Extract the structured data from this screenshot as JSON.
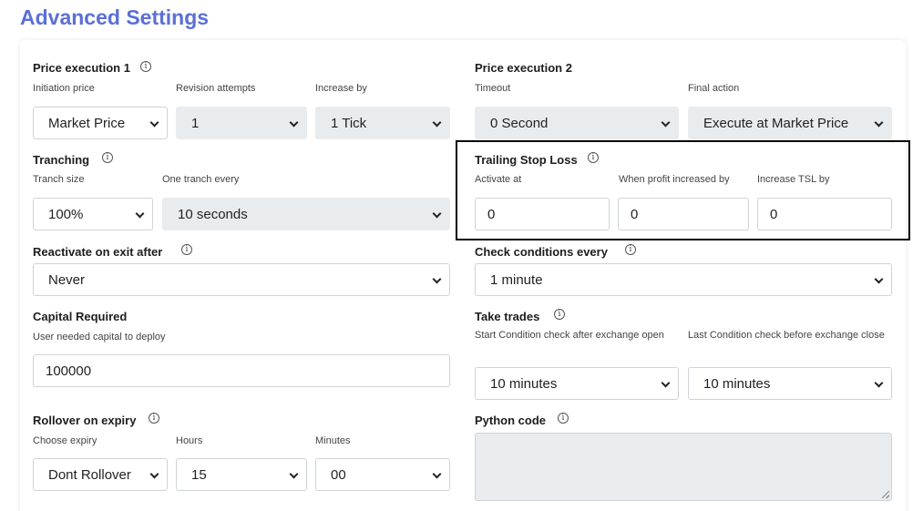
{
  "page_title": "Advanced Settings",
  "price_execution_1": {
    "title": "Price execution 1",
    "initiation_price": {
      "label": "Initiation price",
      "value": "Market Price"
    },
    "revision_attempts": {
      "label": "Revision attempts",
      "value": "1"
    },
    "increase_by": {
      "label": "Increase by",
      "value": "1 Tick"
    }
  },
  "price_execution_2": {
    "title": "Price execution 2",
    "timeout": {
      "label": "Timeout",
      "value": "0 Second"
    },
    "final_action": {
      "label": "Final action",
      "value": "Execute at Market Price"
    }
  },
  "tranching": {
    "title": "Tranching",
    "tranch_size": {
      "label": "Tranch size",
      "value": "100%"
    },
    "one_tranch_every": {
      "label": "One tranch every",
      "value": "10 seconds"
    }
  },
  "trailing_stop_loss": {
    "title": "Trailing Stop Loss",
    "activate_at": {
      "label": "Activate at",
      "value": "0"
    },
    "profit_increased_by": {
      "label": "When profit increased by",
      "value": "0"
    },
    "increase_tsl_by": {
      "label": "Increase TSL by",
      "value": "0"
    }
  },
  "reactivate": {
    "title": "Reactivate on exit after",
    "value": "Never"
  },
  "check_conditions": {
    "title": "Check conditions every",
    "value": "1 minute"
  },
  "capital_required": {
    "title": "Capital Required",
    "label": "User needed capital to deploy",
    "value": "100000"
  },
  "take_trades": {
    "title": "Take trades",
    "start_check": {
      "label": "Start Condition check after exchange open",
      "value": "10 minutes"
    },
    "last_check": {
      "label": "Last Condition check before exchange close",
      "value": "10 minutes"
    }
  },
  "rollover": {
    "title": "Rollover on expiry",
    "choose_expiry": {
      "label": "Choose expiry",
      "value": "Dont Rollover"
    },
    "hours": {
      "label": "Hours",
      "value": "15"
    },
    "minutes": {
      "label": "Minutes",
      "value": "00"
    }
  },
  "python_code": {
    "title": "Python code",
    "value": ""
  },
  "info_glyph": "i"
}
